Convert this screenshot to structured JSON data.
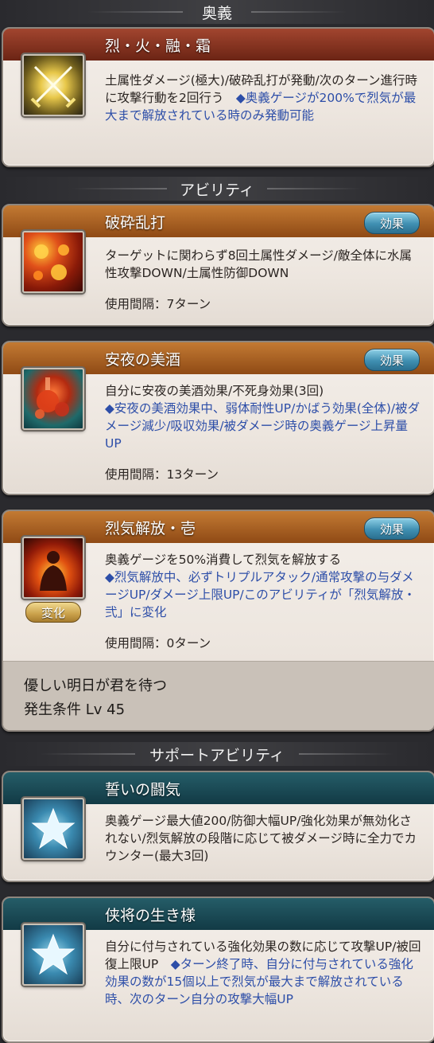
{
  "sections": {
    "ougi": "奥義",
    "abilities": "アビリティ",
    "support": "サポートアビリティ"
  },
  "ougi": {
    "name": "烈・火・融・霜",
    "desc_plain": "土属性ダメージ(極大)/破砕乱打が発動/次のターン進行時に攻撃行動を2回行う　",
    "desc_blue": "◆奥義ゲージが200%で烈気が最大まで解放されている時のみ発動可能"
  },
  "abilities": [
    {
      "name": "破砕乱打",
      "effect_label": "効果",
      "desc_plain": "ターゲットに関わらず8回土属性ダメージ/敵全体に水属性攻撃DOWN/土属性防御DOWN",
      "desc_blue": "",
      "cooldown": "使用間隔：7ターン",
      "icon": "fire-burst-icon"
    },
    {
      "name": "安夜の美酒",
      "effect_label": "効果",
      "desc_plain": "自分に安夜の美酒効果/不死身効果(3回)",
      "desc_blue": "◆安夜の美酒効果中、弱体耐性UP/かばう効果(全体)/被ダメージ減少/吸収効果/被ダメージ時の奥義ゲージ上昇量UP",
      "cooldown": "使用間隔：13ターン",
      "icon": "wine-bottle-icon"
    },
    {
      "name": "烈気解放・壱",
      "effect_label": "効果",
      "change_label": "変化",
      "desc_plain": "奥義ゲージを50%消費して烈気を解放する",
      "desc_blue": "◆烈気解放中、必ずトリプルアタック/通常攻撃の与ダメージUP/ダメージ上限UP/このアビリティが「烈気解放・弐」に変化",
      "cooldown": "使用間隔：0ターン",
      "unlock_name": "優しい明日が君を待つ",
      "unlock_cond": "発生条件 Lv 45",
      "icon": "aura-release-icon"
    }
  ],
  "support": [
    {
      "name": "誓いの闘気",
      "desc_plain": "奥義ゲージ最大値200/防御大幅UP/強化効果が無効化されない/烈気解放の段階に応じて被ダメージ時に全力でカウンター(最大3回)",
      "desc_blue": "",
      "icon": "star-icon"
    },
    {
      "name": "侠将の生き様",
      "desc_plain": "自分に付与されている強化効果の数に応じて攻撃UP/被回復上限UP　",
      "desc_blue": "◆ターン終了時、自分に付与されている強化効果の数が15個以上で烈気が最大まで解放されている時、次のターン自分の攻撃大幅UP",
      "icon": "star-icon"
    }
  ],
  "colors": {
    "blue_text": "#2d4ea8",
    "title_red": "#8a3522",
    "title_orange": "#b06a26",
    "title_teal": "#1b4955"
  }
}
